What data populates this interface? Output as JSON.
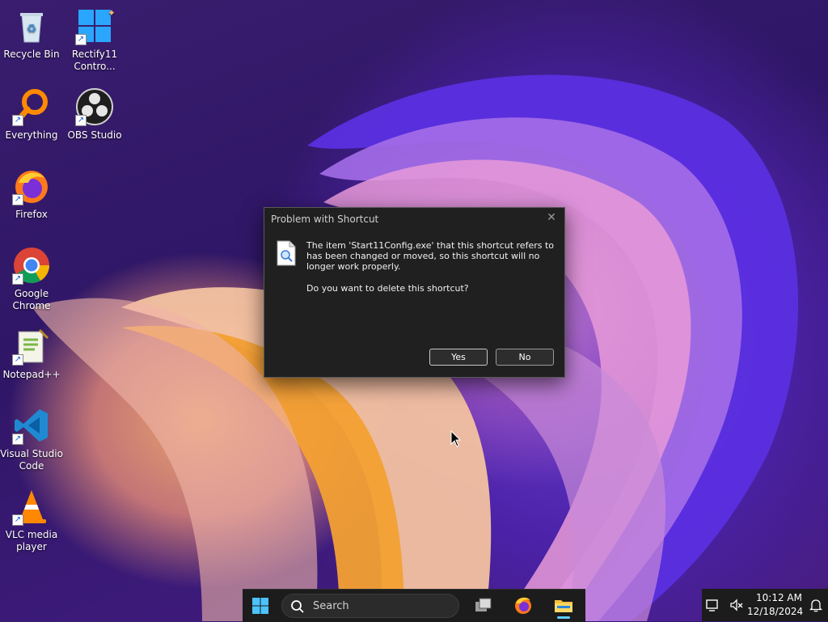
{
  "desktop": {
    "icons": [
      {
        "label": "Recycle Bin"
      },
      {
        "label": "Rectify11\nContro..."
      },
      {
        "label": "Everything"
      },
      {
        "label": "OBS Studio"
      },
      {
        "label": "Firefox"
      },
      {
        "label": "Google\nChrome"
      },
      {
        "label": "Notepad++"
      },
      {
        "label": "Visual Studio\nCode"
      },
      {
        "label": "VLC media\nplayer"
      }
    ]
  },
  "dialog": {
    "title": "Problem with Shortcut",
    "message": "The item 'Start11Config.exe' that this shortcut refers to has been changed or moved, so this shortcut will no longer work properly.",
    "question": "Do you want to delete this shortcut?",
    "yes_label": "Yes",
    "no_label": "No",
    "icon": "document-search-icon"
  },
  "taskbar": {
    "search_text": "Search",
    "apps": [
      "start-icon",
      "task-view-icon",
      "firefox-icon",
      "file-explorer-icon"
    ],
    "accent": "#60cdff"
  },
  "tray": {
    "time": "10:12 AM",
    "date": "12/18/2024"
  }
}
